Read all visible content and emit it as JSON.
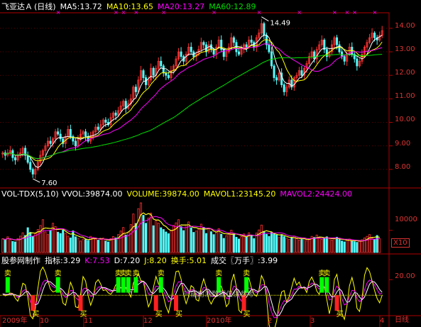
{
  "header_main": {
    "stock_name": "飞亚达Ａ",
    "period": "(日线)",
    "ma5": "MA5:13.72",
    "ma10": "MA10:13.65",
    "ma20": "MA20:13.27",
    "ma60": "MA60:12.89"
  },
  "header_vol": {
    "title": "VOL-TDX(5,10)",
    "vvol": "VVOL:39874.00",
    "volume": "VOLUME:39874.00",
    "mavol1": "MAVOL1:23145.20",
    "mavol2": "MAVOL2:24424.00"
  },
  "header_ind": {
    "title": "股参网制作",
    "zhibiao": "指标:3.29",
    "k": "K:7.53",
    "d": "D:7.20",
    "j": "J:8.20",
    "huanshou": "换手:5.01",
    "chengjiao": "成交〖万手〗:3.99"
  },
  "price_axis": [
    "14.00",
    "13.00",
    "12.00",
    "11.00",
    "10.00",
    "9.00",
    "8.00"
  ],
  "vol_axis": [
    "10000"
  ],
  "vol_unit": "X10",
  "ind_axis": [
    "20.00"
  ],
  "annotations": {
    "high": "14.49",
    "low": "7.60",
    "watermark": "只能用测数据仅供参考"
  },
  "signal_labels": {
    "sell": "卖",
    "buy": "买"
  },
  "date_labels": [
    "2009年",
    "10",
    "11",
    "12",
    "2010年",
    "2",
    "3",
    "4"
  ],
  "corner_label": "日线",
  "colors": {
    "up": "#ff3232",
    "down": "#54ffff",
    "ma5": "#ffffff",
    "ma10": "#ffff00",
    "ma20": "#ff00ff",
    "ma60": "#00e000",
    "axis": "#b00000"
  },
  "chart_data": [
    {
      "type": "candlestick",
      "title": "飞亚达Ａ (日线)",
      "ylim": [
        7.3,
        14.6
      ],
      "close": [
        8.7,
        8.6,
        8.7,
        8.8,
        8.5,
        8.4,
        8.6,
        8.7,
        8.9,
        8.6,
        8.3,
        8.0,
        7.8,
        8.0,
        8.3,
        8.6,
        8.8,
        9.0,
        9.2,
        9.1,
        9.3,
        9.6,
        9.5,
        9.3,
        9.1,
        9.4,
        9.7,
        9.4,
        9.2,
        9.0,
        9.3,
        9.5,
        9.6,
        9.4,
        9.2,
        9.4,
        9.6,
        9.8,
        9.7,
        9.9,
        10.1,
        10.0,
        9.9,
        10.2,
        10.4,
        10.3,
        10.5,
        10.7,
        10.9,
        10.6,
        10.8,
        11.0,
        11.5,
        11.3,
        11.8,
        12.2,
        11.9,
        11.6,
        11.8,
        12.3,
        12.0,
        12.3,
        12.6,
        12.4,
        12.1,
        12.0,
        11.9,
        12.2,
        12.4,
        12.7,
        13.0,
        12.8,
        12.6,
        12.9,
        13.2,
        13.0,
        12.8,
        12.9,
        13.1,
        13.4,
        13.3,
        13.0,
        13.3,
        13.1,
        12.9,
        13.2,
        13.5,
        13.1,
        12.8,
        13.0,
        13.2,
        13.6,
        13.4,
        13.0,
        12.9,
        13.1,
        13.3,
        13.2,
        13.5,
        13.4,
        13.2,
        13.6,
        13.8,
        14.2,
        13.7,
        13.3,
        13.0,
        12.4,
        11.9,
        11.8,
        12.1,
        11.6,
        11.3,
        11.5,
        11.8,
        11.5,
        11.9,
        12.0,
        12.2,
        12.0,
        12.3,
        12.5,
        12.8,
        13.0,
        12.7,
        13.1,
        13.3,
        13.5,
        13.1,
        12.8,
        13.0,
        13.3,
        13.6,
        13.3,
        13.0,
        12.8,
        12.6,
        12.9,
        13.2,
        12.9,
        12.7,
        12.4,
        12.6,
        12.9,
        13.2,
        13.4,
        13.6,
        13.8,
        13.6,
        13.5,
        13.7,
        13.9
      ],
      "annotations": {
        "high": 14.49,
        "low": 7.6
      },
      "series": [
        {
          "name": "MA5",
          "value": 13.72
        },
        {
          "name": "MA10",
          "value": 13.65
        },
        {
          "name": "MA20",
          "value": 13.27
        },
        {
          "name": "MA60",
          "value": 12.89
        }
      ]
    },
    {
      "type": "bar",
      "title": "VOL-TDX(5,10)",
      "ylim": [
        0,
        24000
      ],
      "values": [
        6200,
        5600,
        7100,
        5900,
        5000,
        4800,
        6300,
        7400,
        8900,
        7700,
        11200,
        9100,
        7300,
        8600,
        10400,
        12200,
        14800,
        9300,
        8100,
        9900,
        13200,
        11700,
        9200,
        8600,
        10100,
        8700,
        7400,
        6600,
        9800,
        7100,
        6400,
        5200,
        6100,
        5800,
        5400,
        7300,
        6800,
        6100,
        5600,
        5900,
        6500,
        5200,
        4800,
        6300,
        7200,
        6600,
        8100,
        9700,
        11300,
        7900,
        9200,
        12600,
        17400,
        13100,
        19800,
        22400,
        16800,
        13200,
        15600,
        17800,
        12100,
        14600,
        13300,
        11200,
        10400,
        9300,
        8500,
        10100,
        12200,
        13400,
        14800,
        11700,
        9900,
        12400,
        13800,
        11200,
        9100,
        9700,
        10500,
        12800,
        11400,
        8600,
        10900,
        9400,
        8100,
        9200,
        10800,
        8300,
        6400,
        7600,
        8800,
        10100,
        8400,
        6900,
        6100,
        7200,
        8400,
        7100,
        8900,
        7600,
        6300,
        8800,
        10200,
        12400,
        9600,
        8200,
        7300,
        9100,
        8600,
        7900,
        6800,
        8100,
        7200,
        6500,
        5900,
        6600,
        7400,
        6200,
        5600,
        5900,
        6500,
        5400,
        6100,
        7300,
        6800,
        7900,
        6600,
        5900,
        6300,
        7100,
        6400,
        5600,
        6200,
        6900,
        5800,
        5200,
        4800,
        5500,
        6100,
        5300,
        4900,
        4600,
        5200,
        5800,
        6600,
        7300,
        8100,
        6500,
        5900,
        7700,
        6200
      ]
    },
    {
      "type": "line",
      "title": "股参网制作",
      "ylim": [
        -5,
        30
      ],
      "series": [
        {
          "name": "K",
          "value": 7.53
        },
        {
          "name": "D",
          "value": 7.2
        },
        {
          "name": "J",
          "value": 8.2
        }
      ],
      "sell_signals": [
        2,
        22,
        46,
        48,
        50,
        53,
        63,
        86,
        97,
        127,
        129
      ],
      "buy_signals": [
        12,
        31,
        61,
        69,
        96,
        133
      ]
    }
  ]
}
